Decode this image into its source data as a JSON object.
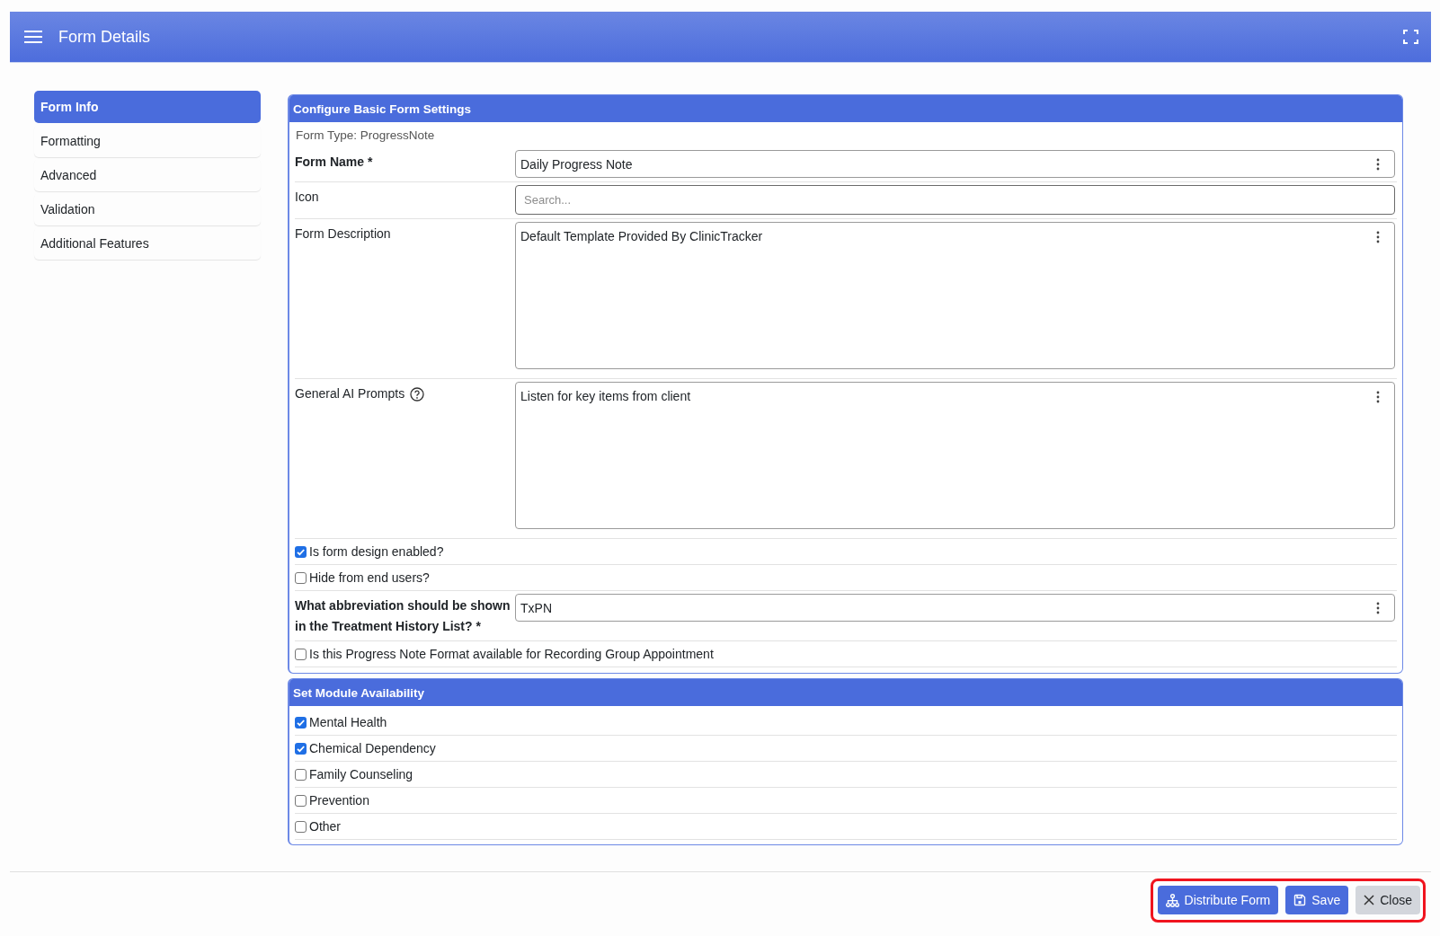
{
  "header": {
    "title": "Form Details"
  },
  "sidebar": {
    "items": [
      {
        "label": "Form Info",
        "selected": true
      },
      {
        "label": "Formatting",
        "selected": false
      },
      {
        "label": "Advanced",
        "selected": false
      },
      {
        "label": "Validation",
        "selected": false
      },
      {
        "label": "Additional Features",
        "selected": false
      }
    ]
  },
  "settings_panel": {
    "title": "Configure Basic Form Settings",
    "form_type": "Form Type: ProgressNote",
    "rows": [
      {
        "kind": "text",
        "label": "Form Name *",
        "required": true,
        "help": false,
        "value": "Daily Progress Note"
      },
      {
        "kind": "search",
        "label": "Icon",
        "required": false,
        "help": false,
        "placeholder": "Search..."
      },
      {
        "kind": "textarea",
        "label": "Form Description",
        "required": false,
        "help": false,
        "value": "Default Template Provided By ClinicTracker"
      },
      {
        "kind": "textarea",
        "label": "General AI Prompts",
        "required": false,
        "help": true,
        "value": "Listen for key items from client"
      },
      {
        "kind": "checkbox",
        "label": "Is form design enabled?",
        "checked": true
      },
      {
        "kind": "checkbox",
        "label": "Hide from end users?",
        "checked": false
      },
      {
        "kind": "text",
        "label": "What abbreviation should be shown in the Treatment History List? *",
        "required": true,
        "help": false,
        "value": "TxPN"
      },
      {
        "kind": "checkbox",
        "label": "Is this Progress Note Format available for Recording Group Appointment",
        "checked": false
      }
    ]
  },
  "module_panel": {
    "title": "Set Module Availability",
    "modules": [
      {
        "label": "Mental Health",
        "checked": true
      },
      {
        "label": "Chemical Dependency",
        "checked": true
      },
      {
        "label": "Family Counseling",
        "checked": false
      },
      {
        "label": "Prevention",
        "checked": false
      },
      {
        "label": "Other",
        "checked": false
      }
    ]
  },
  "footer": {
    "highlighted": true,
    "buttons": [
      {
        "label": "Distribute Form",
        "kind": "primary"
      },
      {
        "label": "Save",
        "kind": "primary"
      },
      {
        "label": "Close",
        "kind": "secondary"
      }
    ]
  }
}
